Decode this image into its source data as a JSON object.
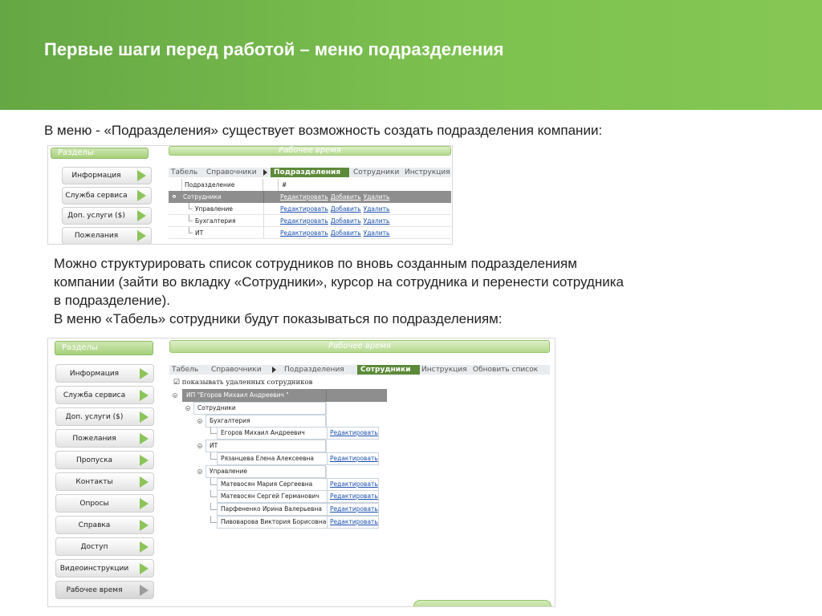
{
  "slide": {
    "title": "Первые шаги перед работой – меню подразделения",
    "text1": "В меню - «Подразделения» существует возможность создать подразделения компании:",
    "text2_line1": "Можно структурировать список сотрудников по вновь созданным подразделениям",
    "text2_line2": "компании (зайти во вкладку «Сотрудники», курсор на сотрудника и перенести сотрудника",
    "text2_line3": "в подразделение).",
    "text3": "В меню «Табель» сотрудники будут показываться по подразделениям:"
  },
  "shot1": {
    "side_header": "Разделы",
    "right_header": "Рабочее время",
    "sidebar": [
      "Информация",
      "Служба сервиса",
      "Доп. услуги ($)",
      "Пожелания"
    ],
    "tabs": [
      "Табель",
      "Справочники",
      "Подразделения",
      "Сотрудники",
      "Инструкция"
    ],
    "active_tab": "Подразделения",
    "columns": [
      "Подразделение",
      "#"
    ],
    "rows": [
      {
        "name": "Сотрудники",
        "level": 0,
        "highlight": true
      },
      {
        "name": "Управление",
        "level": 1
      },
      {
        "name": "Бухгалтерия",
        "level": 1
      },
      {
        "name": "ИТ",
        "level": 1
      }
    ],
    "links": [
      "Редактировать",
      "Добавить",
      "Удалить"
    ]
  },
  "shot2": {
    "side_header": "Разделы",
    "right_header": "Рабочее время",
    "sidebar": [
      "Информация",
      "Служба сервиса",
      "Доп. услуги ($)",
      "Пожелания",
      "Пропуска",
      "Контакты",
      "Опросы",
      "Справка",
      "Доступ",
      "Видеоинструкции",
      "Рабочее время"
    ],
    "tabs": [
      "Табель",
      "Справочники",
      "Подразделения",
      "Сотрудники",
      "Инструкция",
      "Обновить список"
    ],
    "active_tab": "Сотрудники",
    "checkbox_label": "показывать удаленных сотрудников",
    "company": "ИП \"Егоров Михаил Андреевич \"",
    "root": "Сотрудники",
    "edit_link": "Редактировать",
    "groups": [
      {
        "name": "Бухгалтерия",
        "people": [
          "Егоров Михаил Андреевич"
        ]
      },
      {
        "name": "ИТ",
        "people": [
          "Рязанцева Елена Алексеевна"
        ]
      },
      {
        "name": "Управление",
        "people": [
          "Матевосян Мария Сергеевна",
          "Матевосян Сергей Германович",
          "Парфененко Ирина Валерьевна",
          "Пивоварова Виктория Борисовна"
        ]
      }
    ]
  }
}
